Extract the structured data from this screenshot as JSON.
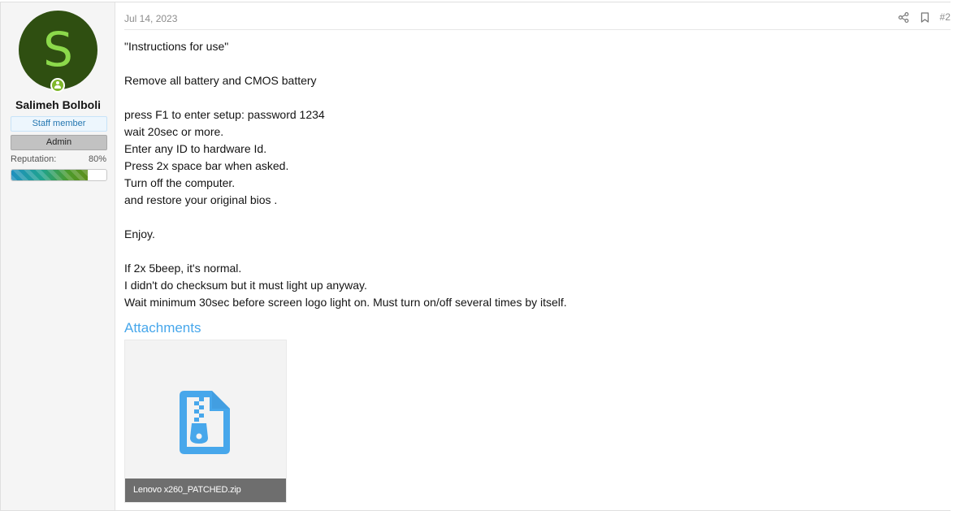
{
  "user": {
    "avatar_letter": "S",
    "name": "Salimeh Bolboli",
    "badges": [
      "Staff member",
      "Admin"
    ],
    "reputation_label": "Reputation:",
    "reputation_value": "80%",
    "reputation_fraction": 0.8
  },
  "post": {
    "date": "Jul 14, 2023",
    "number": "#2",
    "lines": [
      "\"Instructions for use\"",
      "",
      "Remove all battery and CMOS battery",
      "",
      "press F1 to enter setup: password 1234",
      "wait 20sec or more.",
      "Enter any ID to hardware Id.",
      "Press 2x space bar when asked.",
      "Turn off the computer.",
      "and restore your original bios .",
      "",
      "Enjoy.",
      "",
      "If 2x 5beep, it's normal.",
      "I didn't do checksum but it must light up anyway.",
      "Wait minimum 30sec before screen logo light on. Must turn on/off several times by itself."
    ]
  },
  "attachments": {
    "title": "Attachments",
    "items": [
      {
        "name": "Lenovo x260_PATCHED.zip",
        "icon": "zip-file-icon"
      }
    ]
  },
  "icons": {
    "share": "share-icon",
    "bookmark": "bookmark-icon",
    "online": "online-status-icon"
  },
  "colors": {
    "accent": "#47a7eb",
    "avatar_bg": "#2f4f11",
    "avatar_fg": "#8cd94b",
    "online": "#7fb82b"
  }
}
